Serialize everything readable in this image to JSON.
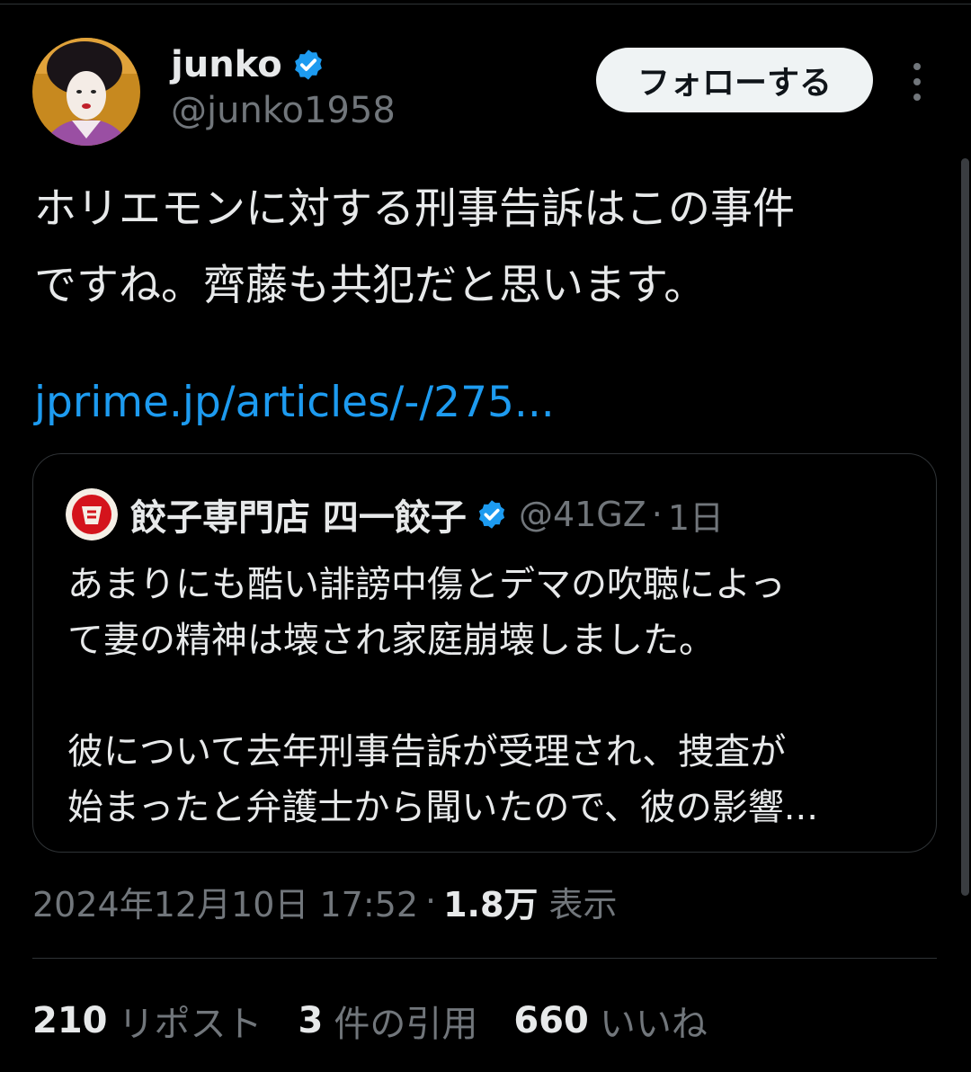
{
  "author": {
    "name": "junko",
    "handle": "@junko1958",
    "verified_icon": "verified-badge-icon"
  },
  "follow_label": "フォローする",
  "more_icon": "more-options-icon",
  "tweet": {
    "text": "ホリエモンに対する刑事告訴はこの事件\nですね。齊藤も共犯だと思います。",
    "link": "jprime.jp/articles/-/275..."
  },
  "quote": {
    "name": "餃子専門店 四一餃子",
    "handle": "@41GZ",
    "dot": "·",
    "time": "1日",
    "text": "あまりにも酷い誹謗中傷とデマの吹聴によっ\nて妻の精神は壊され家庭崩壊しました。\n\n彼について去年刑事告訴が受理され、捜査が\n始まったと弁護士から聞いたので、彼の影響..."
  },
  "meta": {
    "timestamp": "2024年12月10日 17:52",
    "separator": "·",
    "views_count": "1.8万",
    "views_label": "表示"
  },
  "stats": {
    "reposts_count": "210",
    "reposts_label": "リポスト",
    "quotes_count": "3",
    "quotes_label": "件の引用",
    "likes_count": "660",
    "likes_label": "いいね"
  },
  "colors": {
    "background": "#000000",
    "text": "#e7e9ea",
    "secondary": "#71767b",
    "link": "#1d9bf0",
    "verified": "#1d9bf0"
  }
}
